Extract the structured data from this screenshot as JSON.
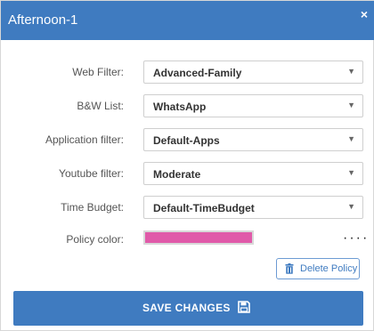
{
  "dialog": {
    "title": "Afternoon-1",
    "close_glyph": "×"
  },
  "fields": [
    {
      "label": "Web Filter:",
      "value": "Advanced-Family"
    },
    {
      "label": "B&W List:",
      "value": "WhatsApp"
    },
    {
      "label": "Application filter:",
      "value": "Default-Apps"
    },
    {
      "label": "Youtube filter:",
      "value": "Moderate"
    },
    {
      "label": "Time Budget:",
      "value": "Default-TimeBudget"
    }
  ],
  "policy_color": {
    "label": "Policy color:",
    "value": "#e05aa9",
    "more_glyph": "····"
  },
  "delete_button": {
    "label": "Delete Policy",
    "icon": "trash-icon"
  },
  "save_button": {
    "label": "SAVE CHANGES",
    "icon": "floppy-disk-icon"
  },
  "colors": {
    "accent": "#3f7bc0",
    "swatch": "#e05aa9"
  }
}
